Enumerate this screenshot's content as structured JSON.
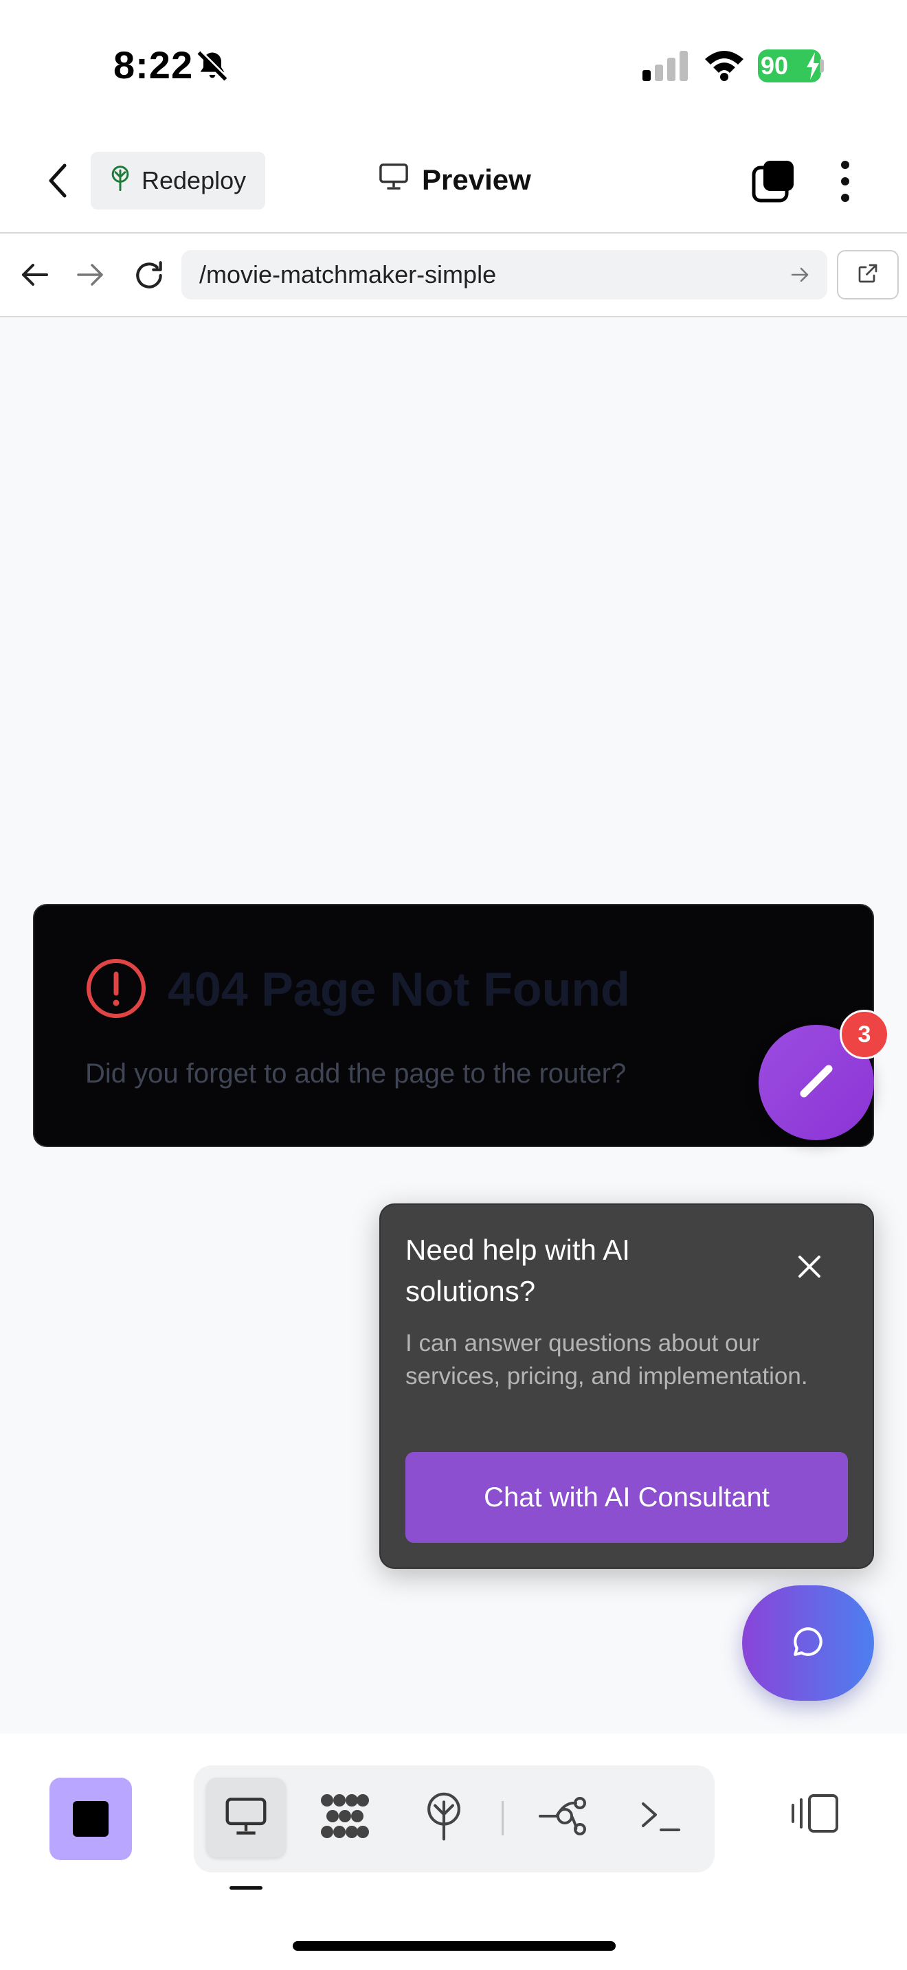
{
  "status_bar": {
    "time": "8:22",
    "battery": "90"
  },
  "toolbar": {
    "redeploy_label": "Redeploy",
    "title": "Preview"
  },
  "address_bar": {
    "url": "/movie-matchmaker-simple"
  },
  "error_card": {
    "title": "404 Page Not Found",
    "description": "Did you forget to add the page to the router?"
  },
  "edit_fab": {
    "badge_count": "3"
  },
  "help_popup": {
    "title": "Need help with AI solutions?",
    "body": "I can answer questions about our services, pricing, and implementation.",
    "cta_label": "Chat with AI Consultant"
  },
  "colors": {
    "accent_purple": "#8b4fd0",
    "badge_red": "#ef4444",
    "error_red": "#e04444",
    "battery_green": "#34c759",
    "stop_button": "#b9a6ff"
  },
  "icons": {
    "status": [
      "bell-slash-icon",
      "cellular-signal-icon",
      "wifi-icon",
      "battery-icon"
    ],
    "toolbar": [
      "back-chevron-icon",
      "tree-icon",
      "monitor-icon",
      "tabs-icon",
      "more-vertical-icon"
    ],
    "address": [
      "arrow-left-icon",
      "arrow-right-icon",
      "reload-icon",
      "go-arrow-icon",
      "external-link-icon"
    ],
    "bottom": [
      "stop-icon",
      "monitor-icon",
      "grid-dots-icon",
      "deploy-icon",
      "git-branch-icon",
      "terminal-icon",
      "panel-toggle-icon"
    ]
  }
}
